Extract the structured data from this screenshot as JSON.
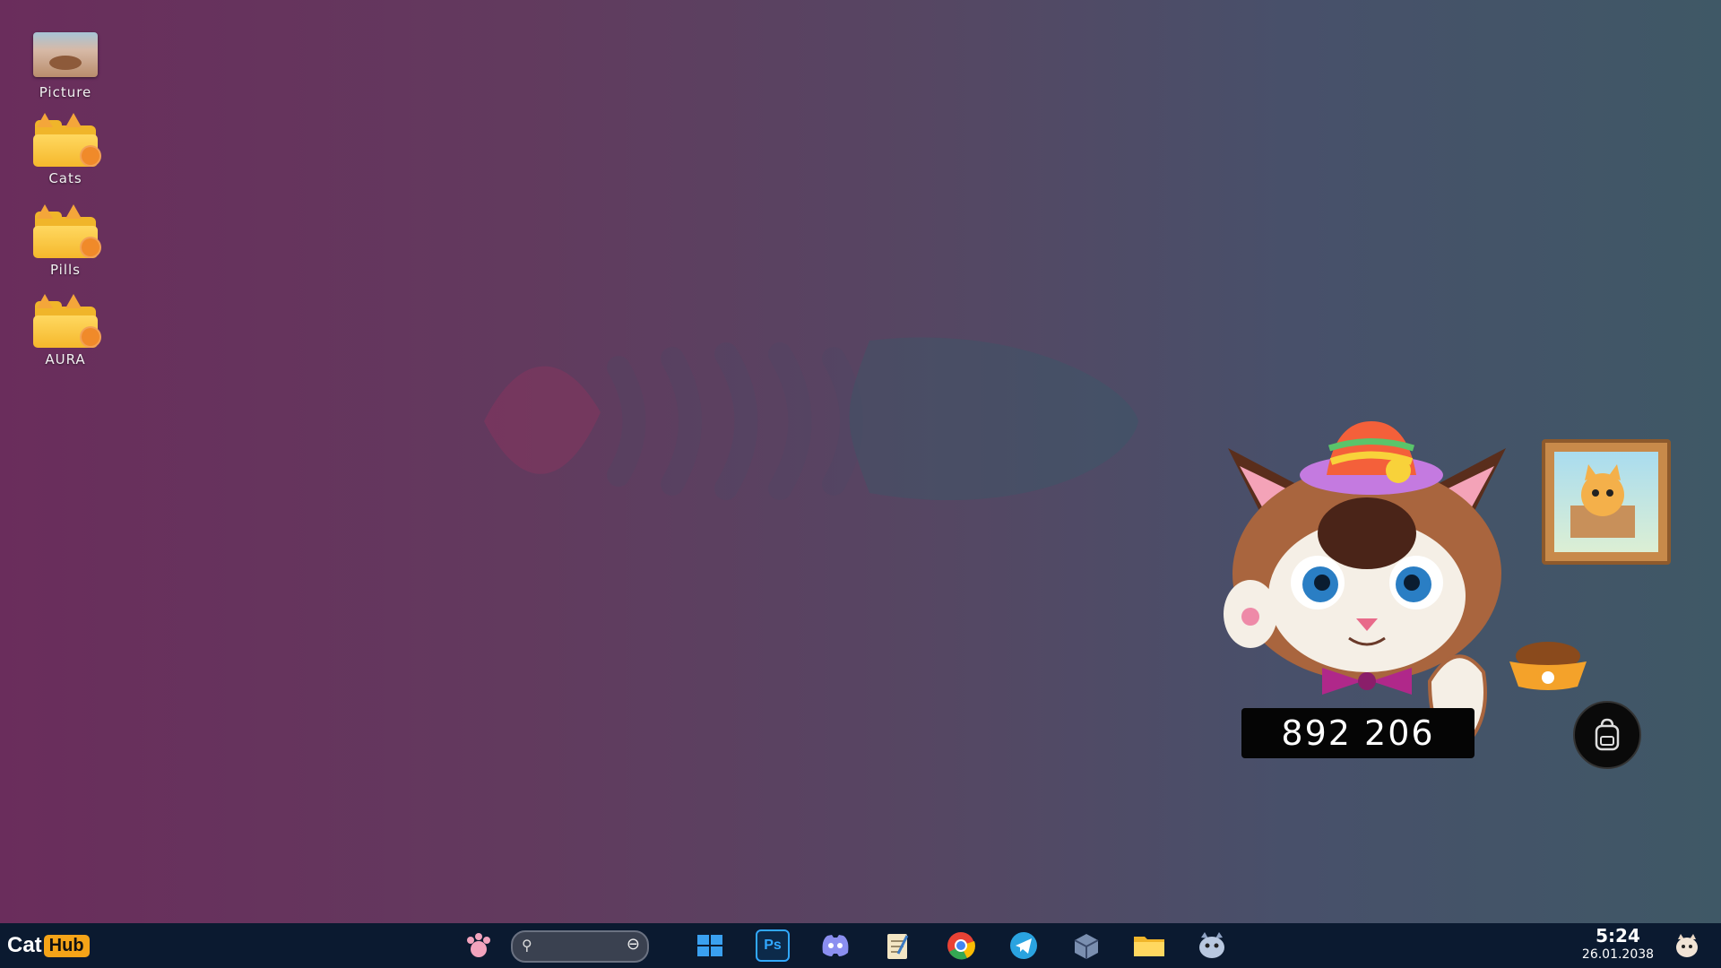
{
  "desktop": {
    "icons": [
      {
        "label": "Picture",
        "icon": "picture-thumbnail"
      },
      {
        "label": "Cats",
        "icon": "cat-folder-icon"
      },
      {
        "label": "Pills",
        "icon": "cat-folder-icon"
      },
      {
        "label": "AURA",
        "icon": "cat-folder-icon"
      }
    ]
  },
  "widget": {
    "counter": "892 206"
  },
  "taskbar": {
    "start_cat": "Cat",
    "start_hub": "Hub",
    "search_placeholder": "",
    "apps": [
      "paw-icon",
      "windows-icon",
      "photoshop-icon",
      "discord-icon",
      "notepad-icon",
      "chrome-icon",
      "telegram-icon",
      "box-icon",
      "folder-icon",
      "cat-app-icon"
    ],
    "photoshop_label": "Ps",
    "clock_time": "5:24",
    "clock_date": "26.01.2038"
  },
  "colors": {
    "taskbar": "#0b1a30",
    "hub_badge": "#f5a418"
  }
}
